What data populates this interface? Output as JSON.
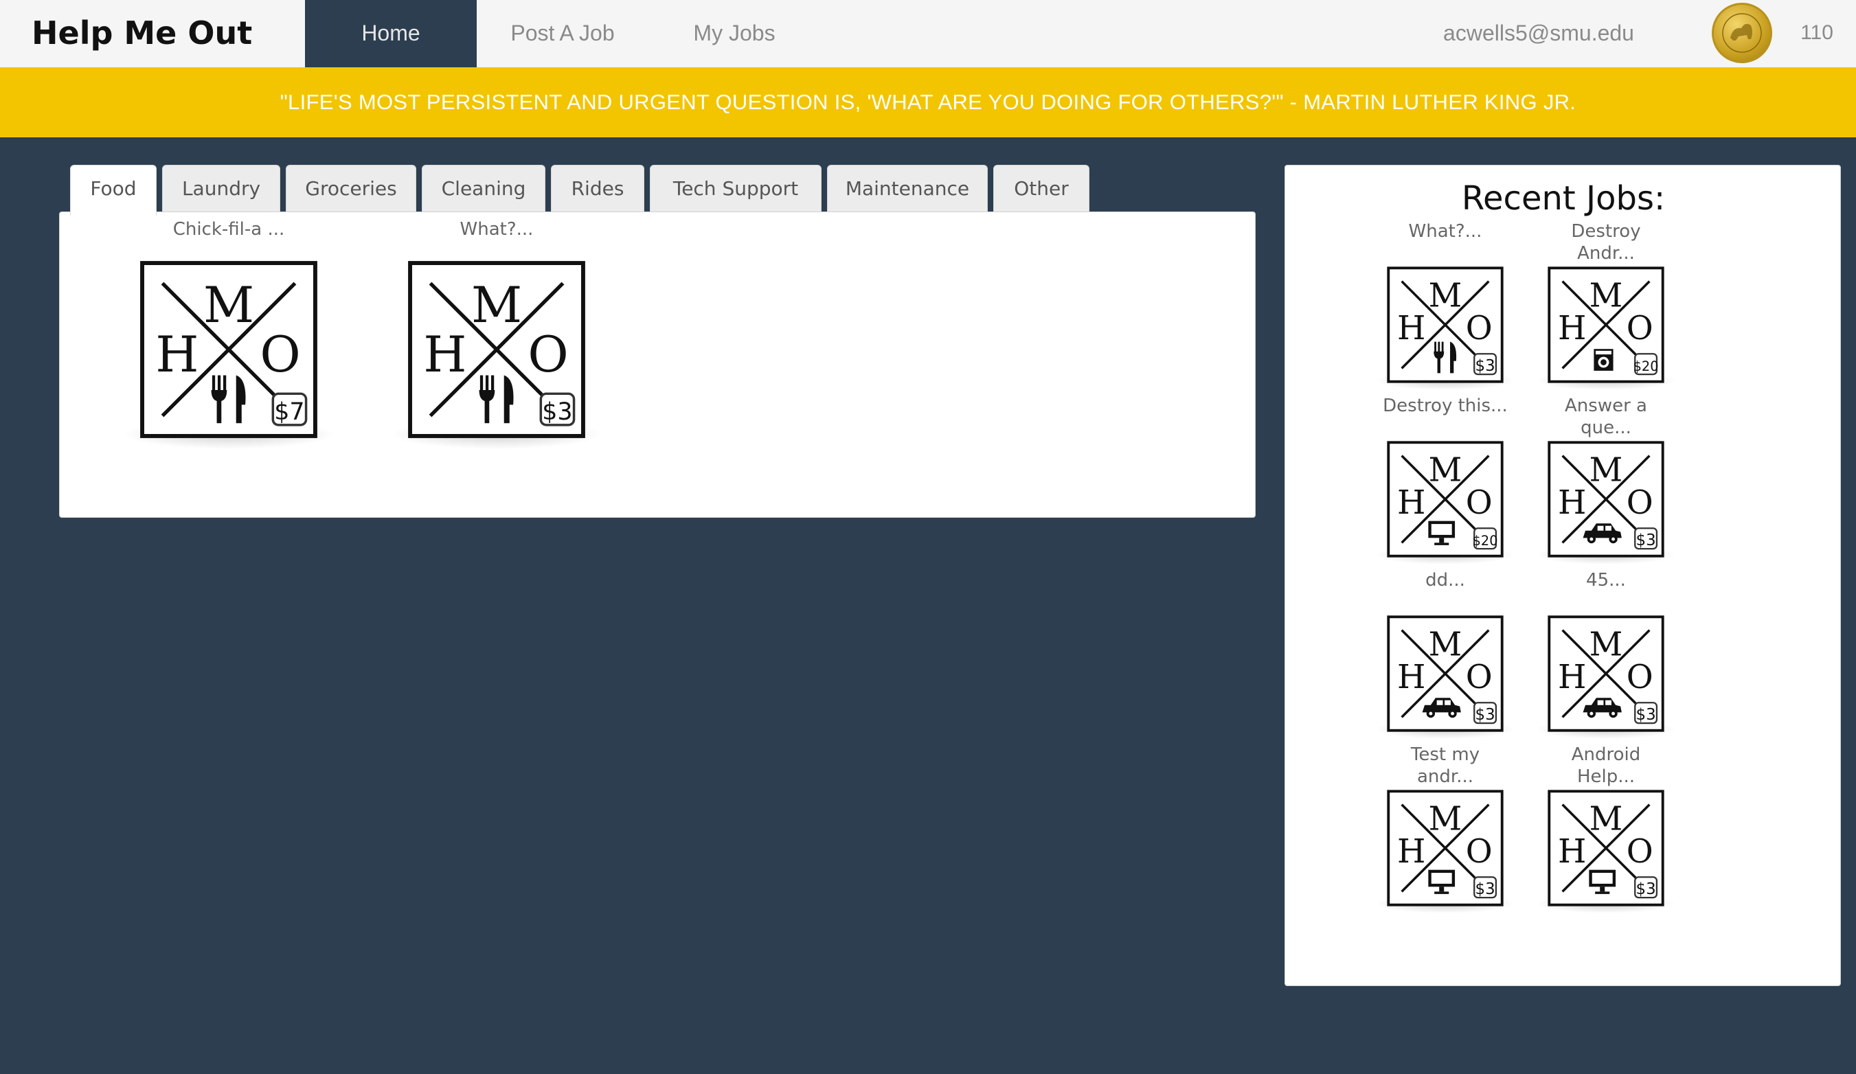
{
  "navbar": {
    "brand": "Help Me Out",
    "items": [
      {
        "label": "Home",
        "active": true
      },
      {
        "label": "Post A Job",
        "active": false
      },
      {
        "label": "My Jobs",
        "active": false
      }
    ],
    "email": "acwells5@smu.edu",
    "avatar_icon": "gold-coin-avatar-icon",
    "points": "110"
  },
  "banner": {
    "quote": "\"LIFE'S MOST PERSISTENT AND URGENT QUESTION IS, 'WHAT ARE YOU DOING FOR OTHERS?'\" - MARTIN LUTHER KING JR."
  },
  "tabs": [
    {
      "label": "Food",
      "active": true
    },
    {
      "label": "Laundry",
      "active": false
    },
    {
      "label": "Groceries",
      "active": false
    },
    {
      "label": "Cleaning",
      "active": false
    },
    {
      "label": "Rides",
      "active": false
    },
    {
      "label": "Tech Support",
      "active": false
    },
    {
      "label": "Maintenance",
      "active": false
    },
    {
      "label": "Other",
      "active": false
    }
  ],
  "jobs": [
    {
      "title": "Chick-fil-a ...",
      "price": "$7",
      "category_icon": "fork-knife-icon"
    },
    {
      "title": "What?...",
      "price": "$3",
      "category_icon": "fork-knife-icon"
    }
  ],
  "recent": {
    "title": "Recent Jobs:",
    "items": [
      {
        "title_lines": [
          "What?..."
        ],
        "price": "$3",
        "category_icon": "fork-knife-icon"
      },
      {
        "title_lines": [
          "Destroy",
          "Andr..."
        ],
        "price": "$20",
        "category_icon": "washing-machine-icon"
      },
      {
        "title_lines": [
          "Destroy this..."
        ],
        "price": "$20",
        "category_icon": "monitor-icon"
      },
      {
        "title_lines": [
          "Answer a",
          "que..."
        ],
        "price": "$3",
        "category_icon": "car-icon"
      },
      {
        "title_lines": [
          "dd..."
        ],
        "price": "$3",
        "category_icon": "car-icon"
      },
      {
        "title_lines": [
          "45..."
        ],
        "price": "$3",
        "category_icon": "car-icon"
      },
      {
        "title_lines": [
          "Test my",
          "andr..."
        ],
        "price": "$3",
        "category_icon": "monitor-icon"
      },
      {
        "title_lines": [
          "Android",
          "Help..."
        ],
        "price": "$3",
        "category_icon": "monitor-icon"
      }
    ]
  },
  "logo_letters": {
    "top": "M",
    "left": "H",
    "right": "O"
  },
  "colors": {
    "background": "#2c3e50",
    "navbar": "#f5f5f5",
    "banner": "#f2c500",
    "active_nav": "#2c3e50"
  }
}
